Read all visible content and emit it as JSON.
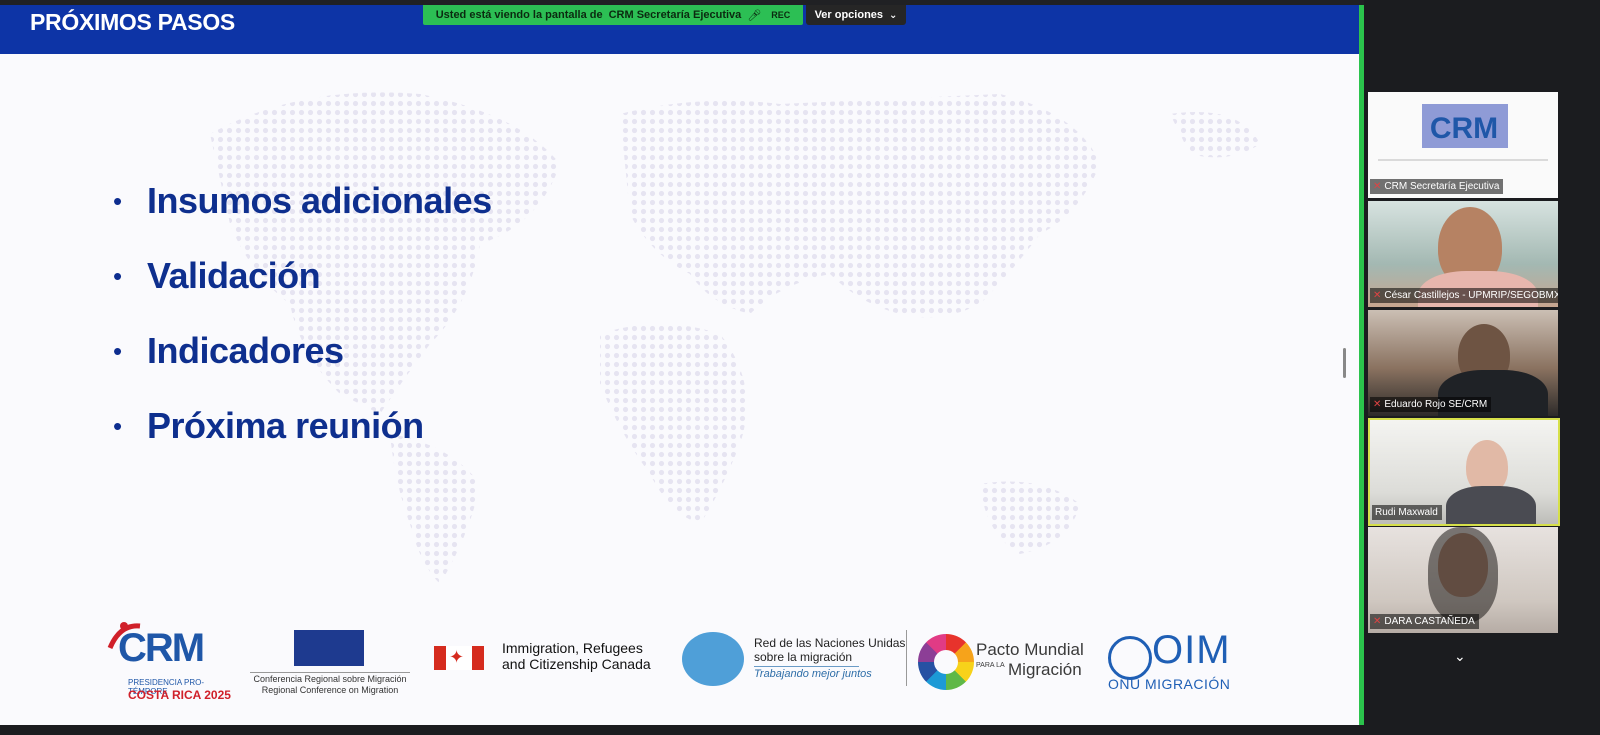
{
  "slide": {
    "title": "PRÓXIMOS PASOS",
    "bullets": [
      "Insumos adicionales",
      "Validación",
      "Indicadores",
      "Próxima reunión"
    ]
  },
  "share_banner": {
    "prefix": "Usted está viendo la pantalla de",
    "presenter": "CRM Secretaría Ejecutiva",
    "rec": "REC",
    "view_options": "Ver opciones"
  },
  "logos": {
    "crm": {
      "name": "CRM",
      "line1": "PRESIDENCIA PRO-TÉMPORE",
      "line2": "COSTA RICA 2025"
    },
    "conference": {
      "line1": "Conferencia Regional sobre Migración",
      "line2": "Regional Conference on Migration"
    },
    "canada": {
      "line1": "Immigration, Refugees",
      "line2": "and Citizenship Canada"
    },
    "un_network": {
      "line1": "Red de las Naciones Unidas",
      "line2": "sobre la migración",
      "tagline": "Trabajando mejor juntos"
    },
    "pacto": {
      "line1": "Pacto Mundial",
      "para_la": "PARA LA",
      "line2": "Migración"
    },
    "oim": {
      "acronym": "OIM",
      "full": "ONU MIGRACIÓN"
    }
  },
  "participants": [
    {
      "name": "CRM Secretaría Ejecutiva",
      "muted": true
    },
    {
      "name": "César Castillejos - UPMRIP/SEGOBMX",
      "muted": true
    },
    {
      "name": "Eduardo Rojo SE/CRM",
      "muted": true
    },
    {
      "name": "Rudi Maxwald",
      "muted": false,
      "active_speaker": true
    },
    {
      "name": "DARA CASTAÑEDA",
      "muted": true
    }
  ],
  "colors": {
    "header_blue": "#0d34a6",
    "bullet_blue": "#0e2f8e",
    "share_green": "#2cbf54",
    "speaker_border": "#d6e04a"
  }
}
